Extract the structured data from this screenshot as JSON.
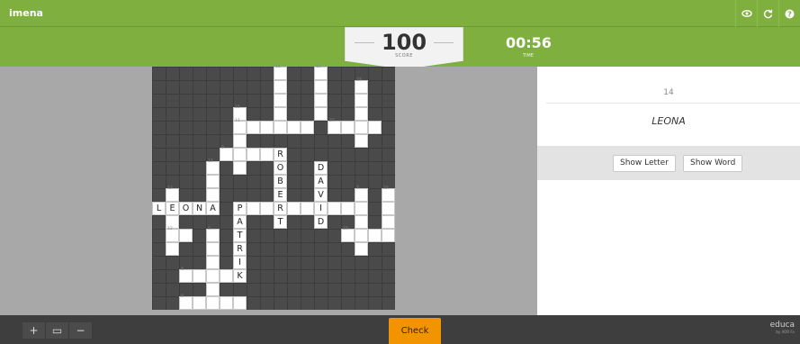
{
  "app": {
    "title": "imena"
  },
  "header_icons": [
    "eye-icon",
    "refresh-icon",
    "help-icon"
  ],
  "score": {
    "value": "100",
    "label": "SCORE"
  },
  "time": {
    "value": "00:56",
    "label": "TIME"
  },
  "clue": {
    "number": "14",
    "text": "LEONA"
  },
  "hints": {
    "show_letter": "Show Letter",
    "show_word": "Show Word"
  },
  "toolbar": {
    "zoom_in": "+",
    "fit": "▭",
    "zoom_out": "−",
    "check": "Check"
  },
  "brand": {
    "name": "educa",
    "sub": "by ADR Fo"
  },
  "colors": {
    "accent_green": "#7fb03f",
    "check_orange": "#f29400",
    "board_dark": "#4a4a4a"
  },
  "crossword": {
    "cols": 18,
    "rows": 18,
    "cells": [
      {
        "c": 9,
        "r": 0,
        "n": "14"
      },
      {
        "c": 12,
        "r": 0,
        "n": "16"
      },
      {
        "c": 9,
        "r": 1
      },
      {
        "c": 12,
        "r": 1
      },
      {
        "c": 15,
        "r": 1,
        "n": "27"
      },
      {
        "c": 9,
        "r": 2
      },
      {
        "c": 12,
        "r": 2
      },
      {
        "c": 15,
        "r": 2
      },
      {
        "c": 6,
        "r": 3,
        "n": "15"
      },
      {
        "c": 9,
        "r": 3
      },
      {
        "c": 12,
        "r": 3
      },
      {
        "c": 15,
        "r": 3
      },
      {
        "c": 6,
        "r": 4,
        "n": "11"
      },
      {
        "c": 7,
        "r": 4
      },
      {
        "c": 8,
        "r": 4
      },
      {
        "c": 9,
        "r": 4
      },
      {
        "c": 10,
        "r": 4
      },
      {
        "c": 11,
        "r": 4
      },
      {
        "c": 13,
        "r": 4,
        "n": "23"
      },
      {
        "c": 14,
        "r": 4
      },
      {
        "c": 15,
        "r": 4
      },
      {
        "c": 16,
        "r": 4
      },
      {
        "c": 6,
        "r": 5
      },
      {
        "c": 15,
        "r": 5
      },
      {
        "c": 5,
        "r": 6,
        "n": "9"
      },
      {
        "c": 6,
        "r": 6
      },
      {
        "c": 7,
        "r": 6
      },
      {
        "c": 8,
        "r": 6
      },
      {
        "c": 9,
        "r": 6,
        "l": "R"
      },
      {
        "c": 4,
        "r": 7,
        "n": "17"
      },
      {
        "c": 6,
        "r": 7
      },
      {
        "c": 9,
        "r": 7,
        "l": "O"
      },
      {
        "c": 12,
        "r": 7,
        "l": "D"
      },
      {
        "c": 4,
        "r": 8
      },
      {
        "c": 9,
        "r": 8,
        "l": "B"
      },
      {
        "c": 12,
        "r": 8,
        "l": "A"
      },
      {
        "c": 1,
        "r": 9,
        "n": "13"
      },
      {
        "c": 4,
        "r": 9
      },
      {
        "c": 9,
        "r": 9,
        "l": "E"
      },
      {
        "c": 12,
        "r": 9,
        "l": "V"
      },
      {
        "c": 15,
        "r": 9,
        "n": "7"
      },
      {
        "c": 17,
        "r": 9,
        "n": "22"
      },
      {
        "c": 0,
        "r": 10,
        "l": "L"
      },
      {
        "c": 1,
        "r": 10,
        "l": "E"
      },
      {
        "c": 2,
        "r": 10,
        "l": "O"
      },
      {
        "c": 3,
        "r": 10,
        "l": "N"
      },
      {
        "c": 4,
        "r": 10,
        "l": "A"
      },
      {
        "c": 6,
        "r": 10,
        "l": "P"
      },
      {
        "c": 7,
        "r": 10
      },
      {
        "c": 8,
        "r": 10
      },
      {
        "c": 9,
        "r": 10,
        "l": "R"
      },
      {
        "c": 10,
        "r": 10
      },
      {
        "c": 11,
        "r": 10
      },
      {
        "c": 12,
        "r": 10,
        "l": "I"
      },
      {
        "c": 13,
        "r": 10
      },
      {
        "c": 14,
        "r": 10
      },
      {
        "c": 15,
        "r": 10
      },
      {
        "c": 17,
        "r": 10
      },
      {
        "c": 1,
        "r": 11
      },
      {
        "c": 6,
        "r": 11,
        "l": "A"
      },
      {
        "c": 9,
        "r": 11,
        "l": "T"
      },
      {
        "c": 12,
        "r": 11,
        "l": "D"
      },
      {
        "c": 15,
        "r": 11
      },
      {
        "c": 17,
        "r": 11
      },
      {
        "c": 1,
        "r": 12,
        "n": "12"
      },
      {
        "c": 2,
        "r": 12
      },
      {
        "c": 4,
        "r": 12,
        "n": "5"
      },
      {
        "c": 6,
        "r": 12,
        "l": "T"
      },
      {
        "c": 14,
        "r": 12,
        "n": "10"
      },
      {
        "c": 15,
        "r": 12
      },
      {
        "c": 16,
        "r": 12
      },
      {
        "c": 17,
        "r": 12
      },
      {
        "c": 1,
        "r": 13
      },
      {
        "c": 4,
        "r": 13
      },
      {
        "c": 6,
        "r": 13,
        "l": "R"
      },
      {
        "c": 15,
        "r": 13
      },
      {
        "c": 4,
        "r": 14
      },
      {
        "c": 6,
        "r": 14,
        "l": "I"
      },
      {
        "c": 2,
        "r": 15,
        "n": "4"
      },
      {
        "c": 3,
        "r": 15
      },
      {
        "c": 4,
        "r": 15
      },
      {
        "c": 5,
        "r": 15
      },
      {
        "c": 6,
        "r": 15,
        "l": "K"
      },
      {
        "c": 4,
        "r": 16
      },
      {
        "c": 2,
        "r": 17,
        "n": "8"
      },
      {
        "c": 3,
        "r": 17
      },
      {
        "c": 4,
        "r": 17
      },
      {
        "c": 5,
        "r": 17
      },
      {
        "c": 6,
        "r": 17
      }
    ]
  }
}
